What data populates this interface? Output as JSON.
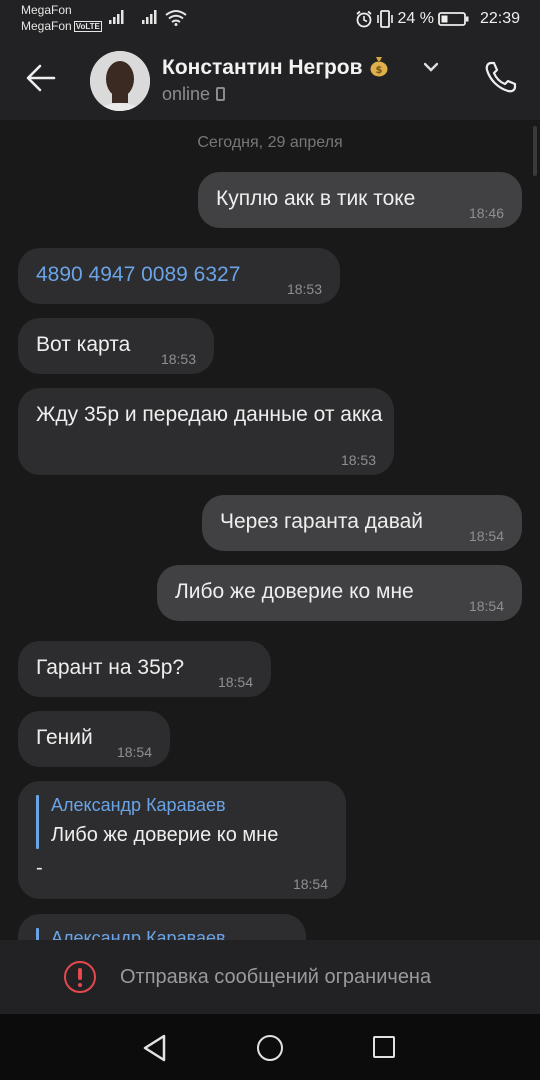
{
  "status_bar": {
    "carrier1": "MegaFon",
    "carrier2": "MegaFon",
    "volte": "VoLTE",
    "battery": "24 %",
    "time": "22:39"
  },
  "header": {
    "contact_name": "Константин Негров",
    "presence": "online"
  },
  "chat": {
    "date_separator": "Сегодня, 29 апреля",
    "messages": [
      {
        "direction": "out",
        "text": "Куплю акк в тик токе",
        "time": "18:46"
      },
      {
        "direction": "in",
        "text": "4890 4947 0089 6327",
        "time": "18:53",
        "is_link": true
      },
      {
        "direction": "in",
        "text": "Вот карта",
        "time": "18:53"
      },
      {
        "direction": "in",
        "text": "Жду 35р и передаю данные от акка",
        "time": "18:53"
      },
      {
        "direction": "out",
        "text": "Через гаранта давай",
        "time": "18:54"
      },
      {
        "direction": "out",
        "text": "Либо же доверие ко мне",
        "time": "18:54"
      },
      {
        "direction": "in",
        "text": "Гарант на 35р?",
        "time": "18:54"
      },
      {
        "direction": "in",
        "text": "Гений",
        "time": "18:54"
      },
      {
        "direction": "in",
        "reply_author": "Александр Караваев",
        "reply_text": "Либо же доверие ко мне",
        "text": "-",
        "time": "18:54"
      },
      {
        "direction": "in",
        "reply_author": "Александр Караваев",
        "partial": true
      }
    ]
  },
  "restriction": {
    "text": "Отправка сообщений ограничена",
    "icon": "warning-circle-icon",
    "color": "#e5484d"
  },
  "nav": {
    "icons": [
      "nav-back-icon",
      "nav-home-icon",
      "nav-recents-icon"
    ]
  },
  "colors": {
    "link": "#6aa4e6",
    "incoming_bubble": "#2d2d2f",
    "outgoing_bubble": "#414143",
    "background": "#19191a"
  }
}
